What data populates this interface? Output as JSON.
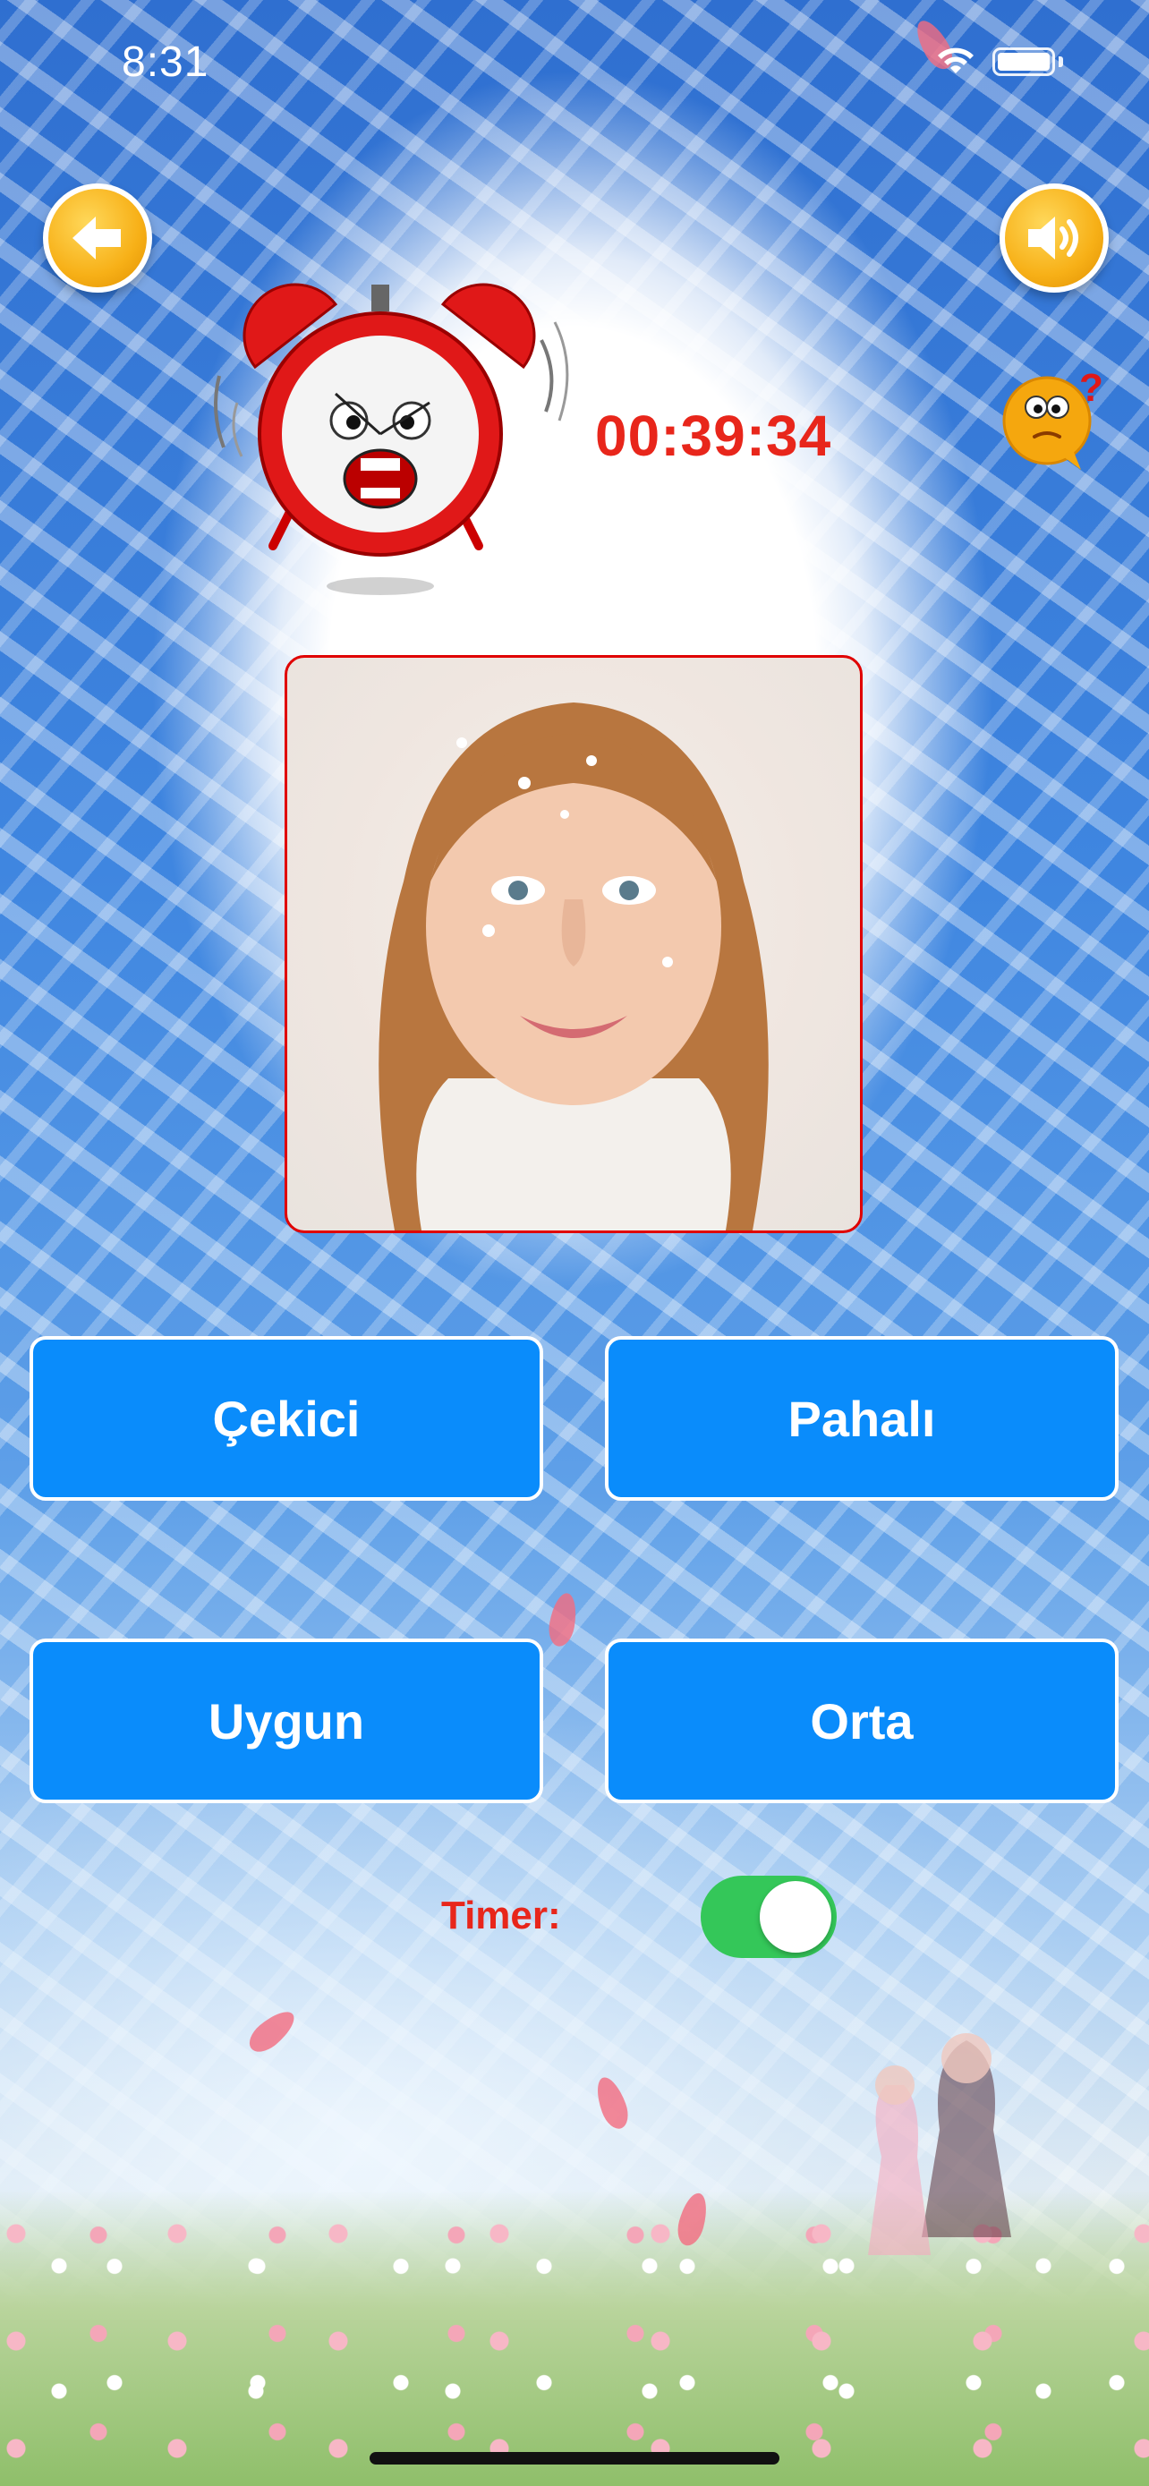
{
  "status_bar": {
    "time": "8:31"
  },
  "header": {
    "timer_value": "00:39:34"
  },
  "answers": [
    {
      "label": "Çekici"
    },
    {
      "label": "Pahalı"
    },
    {
      "label": "Uygun"
    },
    {
      "label": "Orta"
    }
  ],
  "timer_control": {
    "label": "Timer:",
    "enabled": true
  },
  "icons": {
    "back": "back-arrow-icon",
    "sound": "speaker-icon",
    "alarm": "alarm-clock-icon",
    "help": "question-emoji-icon"
  },
  "colors": {
    "answer_button": "#0a8cfb",
    "timer_text": "#e8261b",
    "toggle_on": "#34c759",
    "round_button": "#f7b017"
  }
}
